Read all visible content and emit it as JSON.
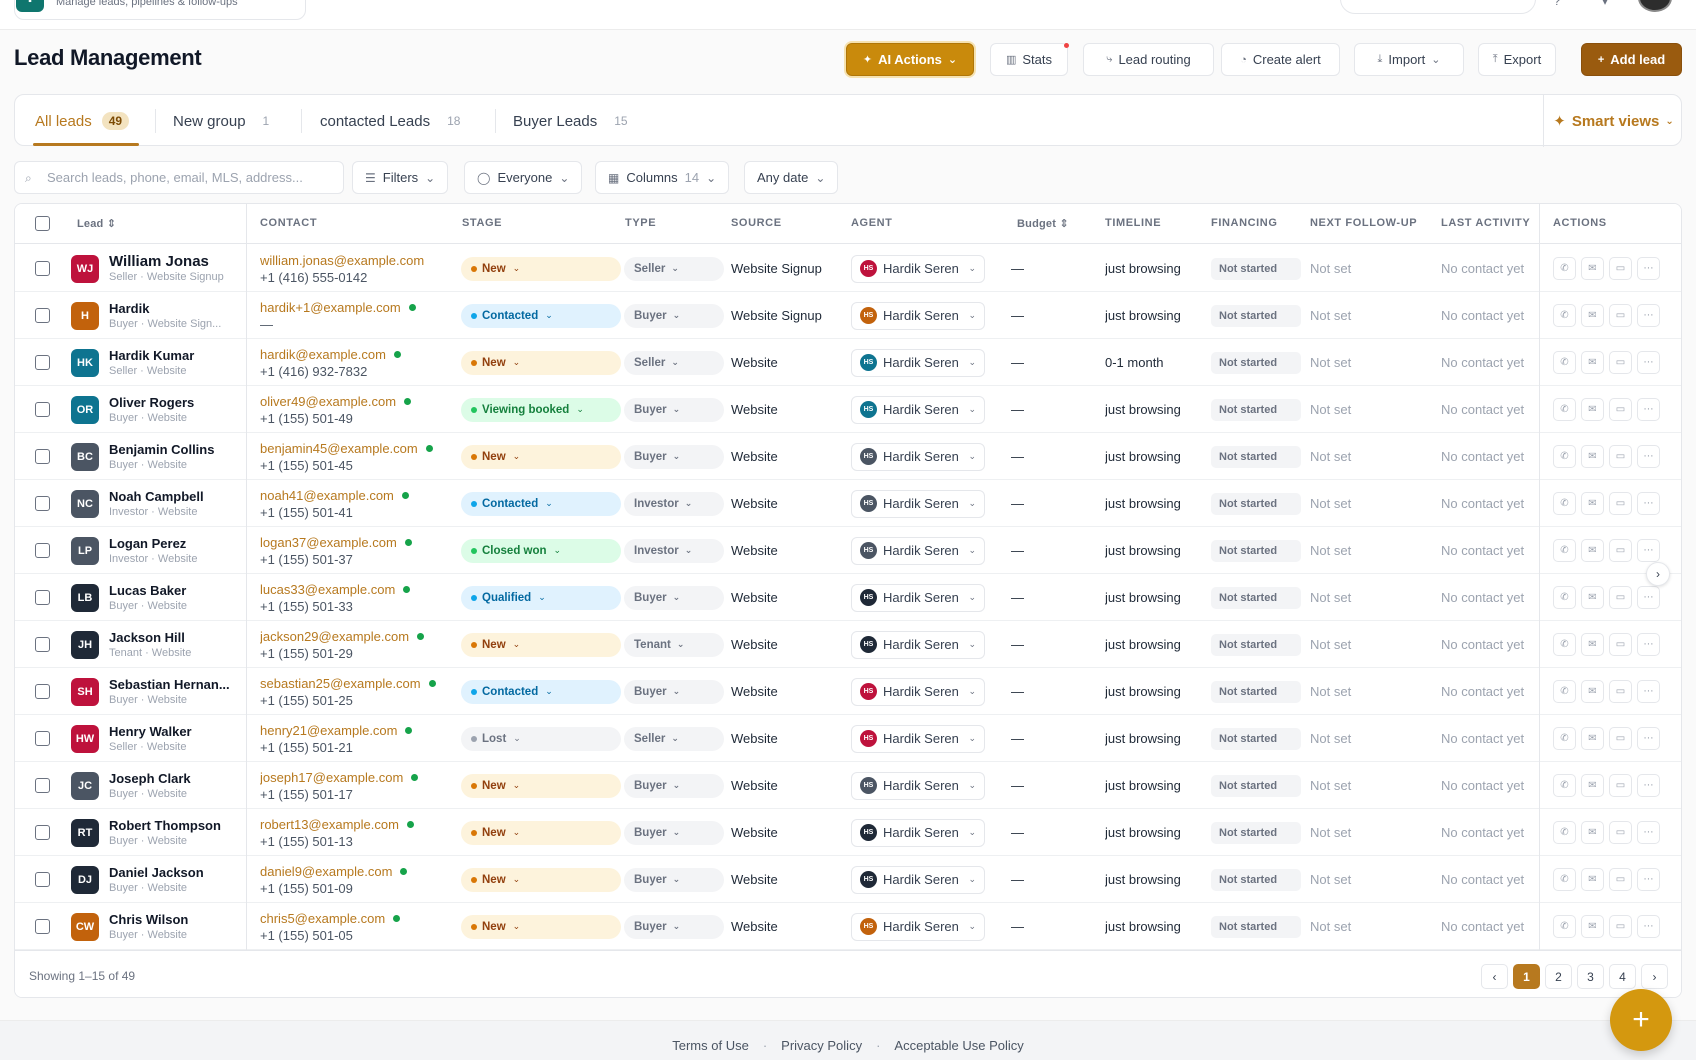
{
  "app": {
    "subtitle": "Manage leads, pipelines & follow-ups",
    "logo": "▪"
  },
  "header": {
    "title": "Lead Management",
    "buttons": {
      "ai_actions": "AI Actions",
      "stats": "Stats",
      "lead_routing": "Lead routing",
      "create_alert": "Create alert",
      "import": "Import",
      "export": "Export",
      "add_lead": "Add lead"
    }
  },
  "tabs": [
    {
      "label": "All leads",
      "count": "49"
    },
    {
      "label": "New group",
      "count": "1"
    },
    {
      "label": "contacted Leads",
      "count": "18"
    },
    {
      "label": "Buyer Leads",
      "count": "15"
    }
  ],
  "smart_views": "Smart views",
  "filters": {
    "search_placeholder": "Search leads, phone, email, MLS, address...",
    "filters_label": "Filters",
    "owner_label": "Everyone",
    "columns_label": "Columns",
    "columns_count": "14",
    "date_label": "Any date"
  },
  "columns": {
    "lead": "Lead",
    "contact": "CONTACT",
    "stage": "STAGE",
    "type": "TYPE",
    "source": "SOURCE",
    "agent": "AGENT",
    "budget": "Budget",
    "timeline": "TIMELINE",
    "financing": "FINANCING",
    "next_follow_up": "NEXT FOLLOW-UP",
    "last_activity": "LAST ACTIVITY",
    "actions": "ACTIONS"
  },
  "colors": {
    "accent": "#b7791f",
    "agent_avatar": {
      "red": "#be123c",
      "orange": "#c2620c",
      "teal": "#0e7490",
      "slate": "#4b5563",
      "dark": "#1f2937"
    },
    "stages": {
      "New": {
        "bg": "#fdf3dc",
        "fg": "#92400e",
        "dot": "#d97706"
      },
      "Contacted": {
        "bg": "#e0f2fe",
        "fg": "#0369a1",
        "dot": "#0ea5e9"
      },
      "Viewing booked": {
        "bg": "#dcfce7",
        "fg": "#15803d",
        "dot": "#22c55e"
      },
      "Closed won": {
        "bg": "#dcfce7",
        "fg": "#15803d",
        "dot": "#22c55e"
      },
      "Qualified": {
        "bg": "#e0f2fe",
        "fg": "#0369a1",
        "dot": "#0ea5e9"
      },
      "Lost": {
        "bg": "#f3f4f6",
        "fg": "#6b7280",
        "dot": "#9ca3af"
      }
    }
  },
  "leads": [
    {
      "initials": "WJ",
      "color": "#be123c",
      "name": "William Jonas",
      "sub": "Seller · Website Signup",
      "email": "william.jonas@example.com",
      "phone": "+1 (416) 555-0142",
      "online": false,
      "stage": "New",
      "type": "Seller",
      "source": "Website Signup",
      "agent_initials": "HS",
      "agent_color": "#be123c",
      "agent": "Hardik Seren",
      "budget": "—",
      "timeline": "just browsing",
      "financing": "Not started",
      "next": "Not set",
      "last": "No contact yet"
    },
    {
      "initials": "H",
      "color": "#c2620c",
      "name": "Hardik",
      "sub": "Buyer · Website Sign...",
      "email": "hardik+1@example.com",
      "phone": "—",
      "online": true,
      "stage": "Contacted",
      "type": "Buyer",
      "source": "Website Signup",
      "agent_initials": "HS",
      "agent_color": "#c2620c",
      "agent": "Hardik Seren",
      "budget": "—",
      "timeline": "just browsing",
      "financing": "Not started",
      "next": "Not set",
      "last": "No contact yet"
    },
    {
      "initials": "HK",
      "color": "#0e7490",
      "name": "Hardik Kumar",
      "sub": "Seller · Website",
      "email": "hardik@example.com",
      "phone": "+1 (416) 932-7832",
      "online": true,
      "stage": "New",
      "type": "Seller",
      "source": "Website",
      "agent_initials": "HS",
      "agent_color": "#0e7490",
      "agent": "Hardik Seren",
      "budget": "—",
      "timeline": "0-1 month",
      "financing": "Not started",
      "next": "Not set",
      "last": "No contact yet"
    },
    {
      "initials": "OR",
      "color": "#0e7490",
      "name": "Oliver Rogers",
      "sub": "Buyer · Website",
      "email": "oliver49@example.com",
      "phone": "+1 (155) 501-49",
      "online": true,
      "stage": "Viewing booked",
      "type": "Buyer",
      "source": "Website",
      "agent_initials": "HS",
      "agent_color": "#0e7490",
      "agent": "Hardik Seren",
      "budget": "—",
      "timeline": "just browsing",
      "financing": "Not started",
      "next": "Not set",
      "last": "No contact yet"
    },
    {
      "initials": "BC",
      "color": "#4b5563",
      "name": "Benjamin Collins",
      "sub": "Buyer · Website",
      "email": "benjamin45@example.com",
      "phone": "+1 (155) 501-45",
      "online": true,
      "stage": "New",
      "type": "Buyer",
      "source": "Website",
      "agent_initials": "HS",
      "agent_color": "#4b5563",
      "agent": "Hardik Seren",
      "budget": "—",
      "timeline": "just browsing",
      "financing": "Not started",
      "next": "Not set",
      "last": "No contact yet"
    },
    {
      "initials": "NC",
      "color": "#4b5563",
      "name": "Noah Campbell",
      "sub": "Investor · Website",
      "email": "noah41@example.com",
      "phone": "+1 (155) 501-41",
      "online": true,
      "stage": "Contacted",
      "type": "Investor",
      "source": "Website",
      "agent_initials": "HS",
      "agent_color": "#4b5563",
      "agent": "Hardik Seren",
      "budget": "—",
      "timeline": "just browsing",
      "financing": "Not started",
      "next": "Not set",
      "last": "No contact yet"
    },
    {
      "initials": "LP",
      "color": "#4b5563",
      "name": "Logan Perez",
      "sub": "Investor · Website",
      "email": "logan37@example.com",
      "phone": "+1 (155) 501-37",
      "online": true,
      "stage": "Closed won",
      "type": "Investor",
      "source": "Website",
      "agent_initials": "HS",
      "agent_color": "#4b5563",
      "agent": "Hardik Seren",
      "budget": "—",
      "timeline": "just browsing",
      "financing": "Not started",
      "next": "Not set",
      "last": "No contact yet"
    },
    {
      "initials": "LB",
      "color": "#1f2937",
      "name": "Lucas Baker",
      "sub": "Buyer · Website",
      "email": "lucas33@example.com",
      "phone": "+1 (155) 501-33",
      "online": true,
      "stage": "Qualified",
      "type": "Buyer",
      "source": "Website",
      "agent_initials": "HS",
      "agent_color": "#1f2937",
      "agent": "Hardik Seren",
      "budget": "—",
      "timeline": "just browsing",
      "financing": "Not started",
      "next": "Not set",
      "last": "No contact yet"
    },
    {
      "initials": "JH",
      "color": "#1f2937",
      "name": "Jackson Hill",
      "sub": "Tenant · Website",
      "email": "jackson29@example.com",
      "phone": "+1 (155) 501-29",
      "online": true,
      "stage": "New",
      "type": "Tenant",
      "source": "Website",
      "agent_initials": "HS",
      "agent_color": "#1f2937",
      "agent": "Hardik Seren",
      "budget": "—",
      "timeline": "just browsing",
      "financing": "Not started",
      "next": "Not set",
      "last": "No contact yet"
    },
    {
      "initials": "SH",
      "color": "#be123c",
      "name": "Sebastian Hernan...",
      "sub": "Buyer · Website",
      "email": "sebastian25@example.com",
      "phone": "+1 (155) 501-25",
      "online": true,
      "stage": "Contacted",
      "type": "Buyer",
      "source": "Website",
      "agent_initials": "HS",
      "agent_color": "#be123c",
      "agent": "Hardik Seren",
      "budget": "—",
      "timeline": "just browsing",
      "financing": "Not started",
      "next": "Not set",
      "last": "No contact yet"
    },
    {
      "initials": "HW",
      "color": "#be123c",
      "name": "Henry Walker",
      "sub": "Seller · Website",
      "email": "henry21@example.com",
      "phone": "+1 (155) 501-21",
      "online": true,
      "stage": "Lost",
      "type": "Seller",
      "source": "Website",
      "agent_initials": "HS",
      "agent_color": "#be123c",
      "agent": "Hardik Seren",
      "budget": "—",
      "timeline": "just browsing",
      "financing": "Not started",
      "next": "Not set",
      "last": "No contact yet"
    },
    {
      "initials": "JC",
      "color": "#4b5563",
      "name": "Joseph Clark",
      "sub": "Buyer · Website",
      "email": "joseph17@example.com",
      "phone": "+1 (155) 501-17",
      "online": true,
      "stage": "New",
      "type": "Buyer",
      "source": "Website",
      "agent_initials": "HS",
      "agent_color": "#4b5563",
      "agent": "Hardik Seren",
      "budget": "—",
      "timeline": "just browsing",
      "financing": "Not started",
      "next": "Not set",
      "last": "No contact yet"
    },
    {
      "initials": "RT",
      "color": "#1f2937",
      "name": "Robert Thompson",
      "sub": "Buyer · Website",
      "email": "robert13@example.com",
      "phone": "+1 (155) 501-13",
      "online": true,
      "stage": "New",
      "type": "Buyer",
      "source": "Website",
      "agent_initials": "HS",
      "agent_color": "#1f2937",
      "agent": "Hardik Seren",
      "budget": "—",
      "timeline": "just browsing",
      "financing": "Not started",
      "next": "Not set",
      "last": "No contact yet"
    },
    {
      "initials": "DJ",
      "color": "#1f2937",
      "name": "Daniel Jackson",
      "sub": "Buyer · Website",
      "email": "daniel9@example.com",
      "phone": "+1 (155) 501-09",
      "online": true,
      "stage": "New",
      "type": "Buyer",
      "source": "Website",
      "agent_initials": "HS",
      "agent_color": "#1f2937",
      "agent": "Hardik Seren",
      "budget": "—",
      "timeline": "just browsing",
      "financing": "Not started",
      "next": "Not set",
      "last": "No contact yet"
    },
    {
      "initials": "CW",
      "color": "#c2620c",
      "name": "Chris Wilson",
      "sub": "Buyer · Website",
      "email": "chris5@example.com",
      "phone": "+1 (155) 501-05",
      "online": true,
      "stage": "New",
      "type": "Buyer",
      "source": "Website",
      "agent_initials": "HS",
      "agent_color": "#c2620c",
      "agent": "Hardik Seren",
      "budget": "—",
      "timeline": "just browsing",
      "financing": "Not started",
      "next": "Not set",
      "last": "No contact yet"
    }
  ],
  "pagination": {
    "showing": "Showing 1–15 of 49",
    "pages": [
      "1",
      "2",
      "3",
      "4"
    ],
    "current": "1"
  },
  "footer": {
    "terms": "Terms of Use",
    "privacy": "Privacy Policy",
    "aup": "Acceptable Use Policy",
    "sep": "·"
  },
  "fab": "+"
}
